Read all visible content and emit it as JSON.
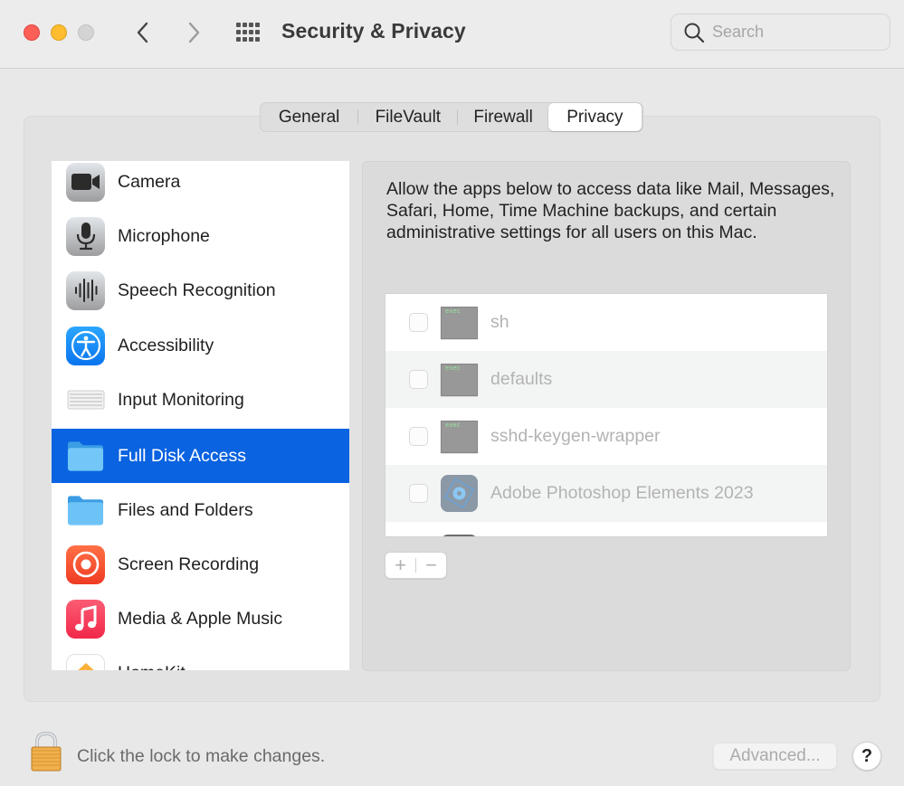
{
  "window": {
    "title": "Security & Privacy",
    "traffic_lights": [
      "close",
      "minimize",
      "zoom"
    ],
    "nav": {
      "back_icon": "chevron-left-icon",
      "forward_icon": "chevron-right-icon",
      "grid_icon": "show-all-grid-icon"
    },
    "search": {
      "placeholder": "Search",
      "value": ""
    }
  },
  "tabs": [
    {
      "label": "General",
      "selected": false
    },
    {
      "label": "FileVault",
      "selected": false
    },
    {
      "label": "Firewall",
      "selected": false
    },
    {
      "label": "Privacy",
      "selected": true
    }
  ],
  "sidebar": {
    "items": [
      {
        "label": "Camera",
        "icon": "camera-icon",
        "selected": false
      },
      {
        "label": "Microphone",
        "icon": "microphone-icon",
        "selected": false
      },
      {
        "label": "Speech Recognition",
        "icon": "waveform-icon",
        "selected": false
      },
      {
        "label": "Accessibility",
        "icon": "accessibility-icon",
        "selected": false
      },
      {
        "label": "Input Monitoring",
        "icon": "keyboard-icon",
        "selected": false
      },
      {
        "label": "Full Disk Access",
        "icon": "folder-icon",
        "selected": true
      },
      {
        "label": "Files and Folders",
        "icon": "folder-icon",
        "selected": false
      },
      {
        "label": "Screen Recording",
        "icon": "screen-record-icon",
        "selected": false
      },
      {
        "label": "Media & Apple Music",
        "icon": "music-note-icon",
        "selected": false
      },
      {
        "label": "HomeKit",
        "icon": "home-icon",
        "selected": false
      }
    ]
  },
  "main": {
    "description": "Allow the apps below to access data like Mail, Messages, Safari, Home, Time Machine backups, and certain administrative settings for all users on this Mac.",
    "apps": [
      {
        "name": "sh",
        "icon": "exec-icon",
        "icon_text": "exec",
        "checked": false
      },
      {
        "name": "defaults",
        "icon": "exec-icon",
        "icon_text": "exec",
        "checked": false
      },
      {
        "name": "sshd-keygen-wrapper",
        "icon": "exec-icon",
        "icon_text": "exec",
        "checked": false
      },
      {
        "name": "Adobe Photoshop Elements 2023",
        "icon": "photoshop-elements-icon",
        "checked": false
      }
    ],
    "add_label": "+",
    "remove_label": "−"
  },
  "footer": {
    "lock_text": "Click the lock to make changes.",
    "advanced_label": "Advanced...",
    "help_label": "?"
  },
  "colors": {
    "selection": "#0a63e0",
    "close": "#fe5f57",
    "minimize": "#febc2e",
    "zoom_disabled": "#d4d4d4"
  }
}
